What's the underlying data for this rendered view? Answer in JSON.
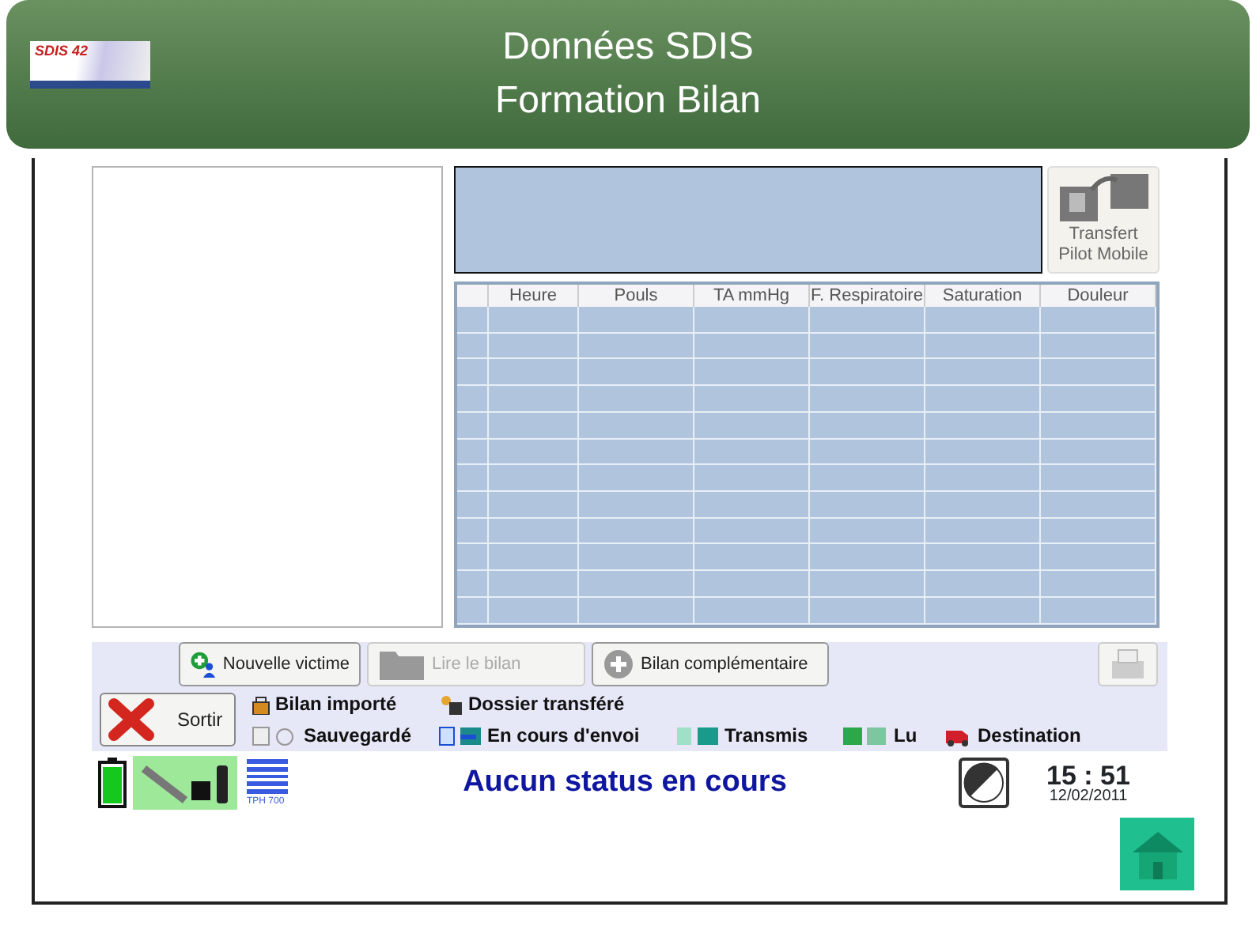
{
  "slide": {
    "title_lines": [
      "Données SDIS",
      "Formation Bilan"
    ],
    "logo_text": "SDIS 42"
  },
  "app": {
    "transfer_button": {
      "lines": [
        "Transfert",
        "Pilot Mobile"
      ]
    },
    "table": {
      "columns": [
        "Heure",
        "Pouls",
        "TA mmHg",
        "F. Respiratoire",
        "Saturation",
        "Douleur"
      ]
    },
    "action_buttons": [
      {
        "kind": "add_victim",
        "label": "Nouvelle victime",
        "disabled": false
      },
      {
        "kind": "folder",
        "label": "Lire le bilan",
        "disabled": true
      },
      {
        "kind": "plus",
        "label": "Bilan complémentaire",
        "disabled": false
      }
    ],
    "exit_button": {
      "label": "Sortir"
    },
    "legend_rows": [
      [
        {
          "kind": "lock",
          "label": "Bilan importé"
        },
        {
          "kind": "folder_lock",
          "label": "Dossier transféré"
        }
      ],
      [
        {
          "kind": "save",
          "label": "Sauvegardé"
        },
        {
          "kind": "sending",
          "label": "En cours d'envoi"
        },
        {
          "kind": "sent",
          "label": "Transmis"
        },
        {
          "kind": "read",
          "label": "Lu"
        },
        {
          "kind": "truck",
          "label": "Destination"
        }
      ]
    ],
    "status_bar": {
      "radio_label": "TPH 700",
      "status_text": "Aucun status en cours",
      "time": "15 : 51",
      "date": "12/02/2011"
    }
  }
}
